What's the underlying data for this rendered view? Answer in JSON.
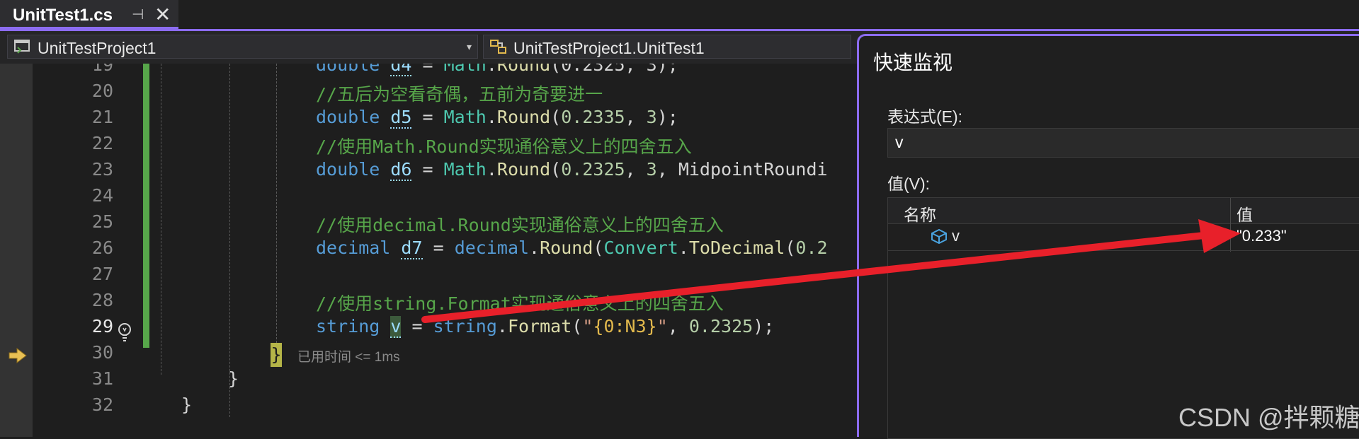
{
  "tab": {
    "title": "UnitTest1.cs",
    "pin_glyph": "⊣",
    "close_glyph": "✕"
  },
  "navbar": {
    "project": "UnitTestProject1",
    "class_path": "UnitTestProject1.UnitTest1",
    "dropdown_glyph": "▾"
  },
  "editor": {
    "line_numbers": [
      "19",
      "20",
      "21",
      "22",
      "23",
      "24",
      "25",
      "26",
      "27",
      "28",
      "29",
      "30",
      "31",
      "32"
    ],
    "lines": {
      "l19": {
        "kw": "double ",
        "var": "d4",
        "rest1": " = ",
        "cls": "Math",
        "dot": ".",
        "fn": "Round",
        "args": "(0.2325, 3);"
      },
      "l20": "//五后为空看奇偶，五前为奇要进一",
      "l21": {
        "kw": "double ",
        "var": "d5",
        "rest1": " = ",
        "cls": "Math",
        "dot": ".",
        "fn": "Round",
        "open": "(",
        "n1": "0.2335",
        "sep": ", ",
        "n2": "3",
        "close": ");"
      },
      "l22": "//使用Math.Round实现通俗意义上的四舍五入",
      "l23": {
        "kw": "double ",
        "var": "d6",
        "rest1": " = ",
        "cls": "Math",
        "dot": ".",
        "fn": "Round",
        "open": "(",
        "n1": "0.2325",
        "sep": ", ",
        "n2": "3",
        "sep2": ", ",
        "cls2": "MidpointRoundi"
      },
      "l25": "//使用decimal.Round实现通俗意义上的四舍五入",
      "l26": {
        "kw": "decimal ",
        "var": "d7",
        "rest1": " = ",
        "kw2": "decimal",
        "dot": ".",
        "fn": "Round",
        "open": "(",
        "cls": "Convert",
        "dot2": ".",
        "fn2": "ToDecimal",
        "open2": "(",
        "n1": "0.2"
      },
      "l28": "//使用string.Format实现通俗意义上的四舍五入",
      "l29": {
        "kw": "string ",
        "var": "v",
        "rest1": " = ",
        "kw2": "string",
        "dot": ".",
        "fn": "Format",
        "open": "(",
        "q1": "\"",
        "fmt": "{0:N3}",
        "q2": "\"",
        "sep": ", ",
        "n1": "0.2325",
        "close": ");"
      },
      "l30_brace": "}",
      "l31": "}",
      "l32": "}"
    },
    "elapsed": "已用时间 <= 1ms"
  },
  "quickwatch": {
    "title": "快速监视",
    "expression_label": "表达式(E):",
    "expression_value": "v",
    "value_label": "值(V):",
    "columns": {
      "name": "名称",
      "value": "值"
    },
    "rows": [
      {
        "name": "v",
        "value": "\"0.233\""
      }
    ]
  },
  "watermark": "CSDN @拌颗糖",
  "colors": {
    "accent": "#8c6cf0",
    "annotation_arrow": "#e8202a",
    "change_bar": "#57a64a"
  }
}
